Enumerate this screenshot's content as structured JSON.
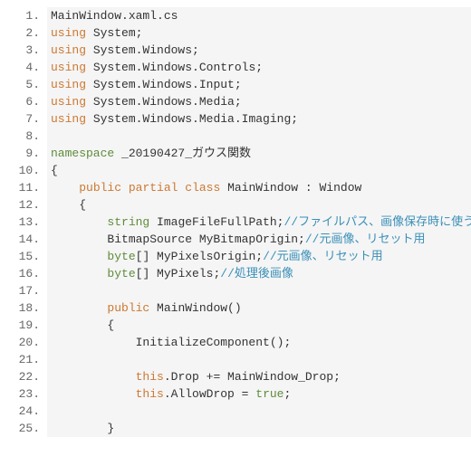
{
  "lines": [
    {
      "num": "1.",
      "tokens": [
        {
          "cls": "",
          "t": "MainWindow.xaml.cs"
        }
      ]
    },
    {
      "num": "2.",
      "tokens": [
        {
          "cls": "kw-using",
          "t": "using"
        },
        {
          "cls": "",
          "t": " System;"
        }
      ]
    },
    {
      "num": "3.",
      "tokens": [
        {
          "cls": "kw-using",
          "t": "using"
        },
        {
          "cls": "",
          "t": " System.Windows;"
        }
      ]
    },
    {
      "num": "4.",
      "tokens": [
        {
          "cls": "kw-using",
          "t": "using"
        },
        {
          "cls": "",
          "t": " System.Windows.Controls;"
        }
      ]
    },
    {
      "num": "5.",
      "tokens": [
        {
          "cls": "kw-using",
          "t": "using"
        },
        {
          "cls": "",
          "t": " System.Windows.Input;"
        }
      ]
    },
    {
      "num": "6.",
      "tokens": [
        {
          "cls": "kw-using",
          "t": "using"
        },
        {
          "cls": "",
          "t": " System.Windows.Media;"
        }
      ]
    },
    {
      "num": "7.",
      "tokens": [
        {
          "cls": "kw-using",
          "t": "using"
        },
        {
          "cls": "",
          "t": " System.Windows.Media.Imaging;"
        }
      ]
    },
    {
      "num": "8.",
      "tokens": [
        {
          "cls": "",
          "t": ""
        }
      ]
    },
    {
      "num": "9.",
      "tokens": [
        {
          "cls": "kw-nsp",
          "t": "namespace"
        },
        {
          "cls": "",
          "t": " _20190427_ガウス関数"
        }
      ]
    },
    {
      "num": "10.",
      "tokens": [
        {
          "cls": "",
          "t": "{"
        }
      ]
    },
    {
      "num": "11.",
      "tokens": [
        {
          "cls": "",
          "t": "    "
        },
        {
          "cls": "kw-mod",
          "t": "public"
        },
        {
          "cls": "",
          "t": " "
        },
        {
          "cls": "kw-mod",
          "t": "partial"
        },
        {
          "cls": "",
          "t": " "
        },
        {
          "cls": "kw-mod",
          "t": "class"
        },
        {
          "cls": "",
          "t": " MainWindow : Window"
        }
      ]
    },
    {
      "num": "12.",
      "tokens": [
        {
          "cls": "",
          "t": "    {"
        }
      ]
    },
    {
      "num": "13.",
      "tokens": [
        {
          "cls": "",
          "t": "        "
        },
        {
          "cls": "kw-type",
          "t": "string"
        },
        {
          "cls": "",
          "t": " ImageFileFullPath;"
        },
        {
          "cls": "comment",
          "t": "//ファイルパス、画像保存時に使う"
        }
      ]
    },
    {
      "num": "14.",
      "tokens": [
        {
          "cls": "",
          "t": "        BitmapSource MyBitmapOrigin;"
        },
        {
          "cls": "comment",
          "t": "//元画像、リセット用"
        }
      ]
    },
    {
      "num": "15.",
      "tokens": [
        {
          "cls": "",
          "t": "        "
        },
        {
          "cls": "kw-type",
          "t": "byte"
        },
        {
          "cls": "",
          "t": "[] MyPixelsOrigin;"
        },
        {
          "cls": "comment",
          "t": "//元画像、リセット用"
        }
      ]
    },
    {
      "num": "16.",
      "tokens": [
        {
          "cls": "",
          "t": "        "
        },
        {
          "cls": "kw-type",
          "t": "byte"
        },
        {
          "cls": "",
          "t": "[] MyPixels;"
        },
        {
          "cls": "comment",
          "t": "//処理後画像"
        }
      ]
    },
    {
      "num": "17.",
      "tokens": [
        {
          "cls": "",
          "t": ""
        }
      ]
    },
    {
      "num": "18.",
      "tokens": [
        {
          "cls": "",
          "t": "        "
        },
        {
          "cls": "kw-mod",
          "t": "public"
        },
        {
          "cls": "",
          "t": " MainWindow()"
        }
      ]
    },
    {
      "num": "19.",
      "tokens": [
        {
          "cls": "",
          "t": "        {"
        }
      ]
    },
    {
      "num": "20.",
      "tokens": [
        {
          "cls": "",
          "t": "            InitializeComponent();"
        }
      ]
    },
    {
      "num": "21.",
      "tokens": [
        {
          "cls": "",
          "t": ""
        }
      ]
    },
    {
      "num": "22.",
      "tokens": [
        {
          "cls": "",
          "t": "            "
        },
        {
          "cls": "kw-this",
          "t": "this"
        },
        {
          "cls": "",
          "t": ".Drop += MainWindow_Drop;"
        }
      ]
    },
    {
      "num": "23.",
      "tokens": [
        {
          "cls": "",
          "t": "            "
        },
        {
          "cls": "kw-this",
          "t": "this"
        },
        {
          "cls": "",
          "t": ".AllowDrop = "
        },
        {
          "cls": "kw-bool",
          "t": "true"
        },
        {
          "cls": "",
          "t": ";"
        }
      ]
    },
    {
      "num": "24.",
      "tokens": [
        {
          "cls": "",
          "t": ""
        }
      ]
    },
    {
      "num": "25.",
      "tokens": [
        {
          "cls": "",
          "t": "        }"
        }
      ]
    }
  ]
}
